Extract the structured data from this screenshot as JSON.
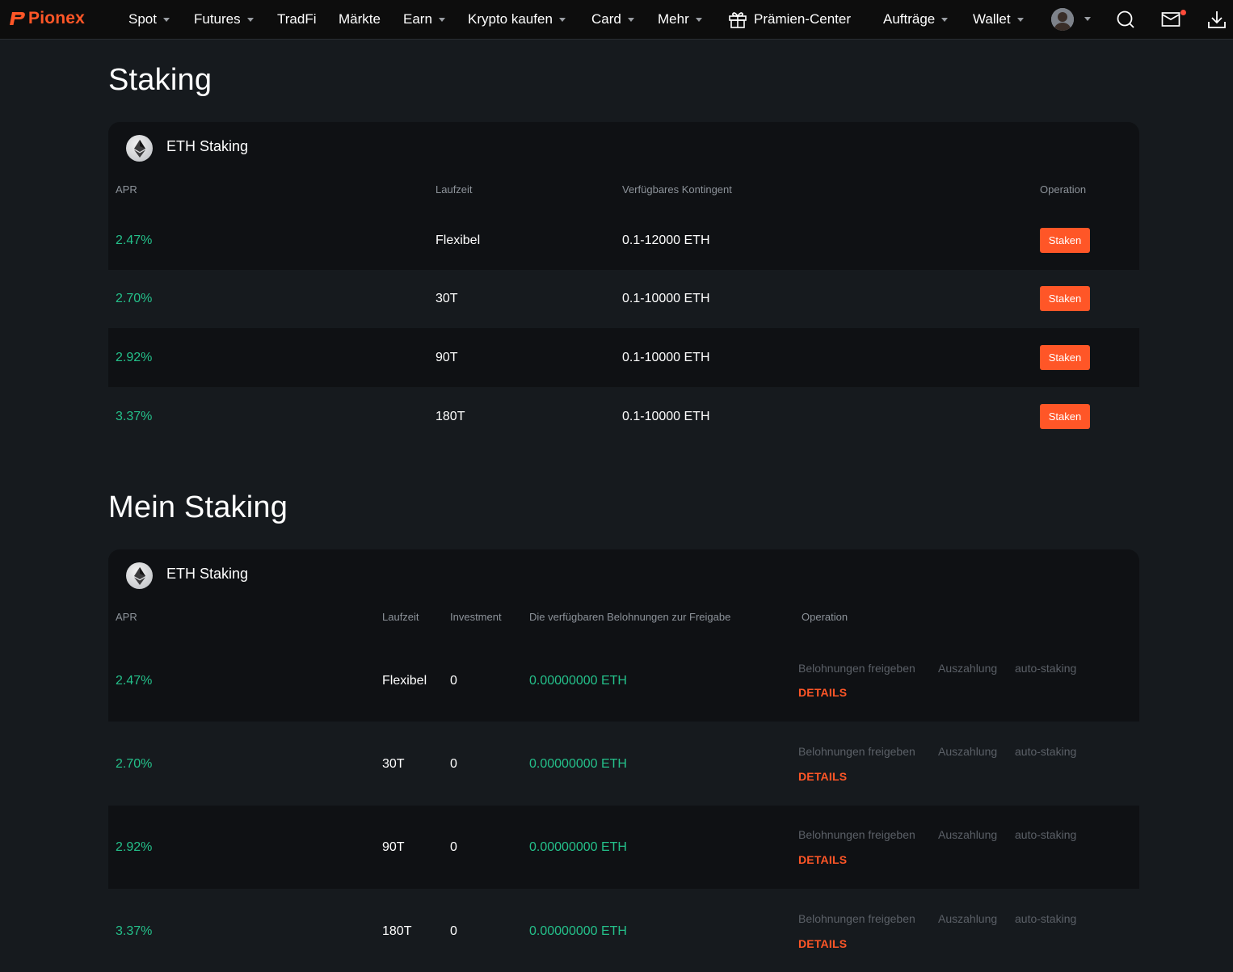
{
  "nav": {
    "brand": "Pionex",
    "items": [
      {
        "label": "Spot",
        "dropdown": true
      },
      {
        "label": "Futures",
        "dropdown": true
      },
      {
        "label": "TradFi",
        "dropdown": false
      },
      {
        "label": "Märkte",
        "dropdown": false
      },
      {
        "label": "Earn",
        "dropdown": true
      },
      {
        "label": "Krypto kaufen",
        "dropdown": true
      },
      {
        "label": "Card",
        "dropdown": true
      },
      {
        "label": "Mehr",
        "dropdown": true
      },
      {
        "label": "Prämien-Center",
        "dropdown": false
      },
      {
        "label": "Aufträge",
        "dropdown": true
      },
      {
        "label": "Wallet",
        "dropdown": true
      }
    ],
    "icons": [
      "gift-icon",
      "avatar",
      "search-icon",
      "mail-icon",
      "download-icon"
    ],
    "accent": "#ff5627"
  },
  "staking": {
    "title": "Staking",
    "card_name": "ETH Staking",
    "headers": {
      "apr": "APR",
      "duration": "Laufzeit",
      "quota": "Verfügbares Kontingent",
      "operation": "Operation"
    },
    "rows": [
      {
        "apr": "2.47%",
        "duration": "Flexibel",
        "quota": "0.1-12000 ETH",
        "button": "Staken"
      },
      {
        "apr": "2.70%",
        "duration": "30T",
        "quota": "0.1-10000 ETH",
        "button": "Staken"
      },
      {
        "apr": "2.92%",
        "duration": "90T",
        "quota": "0.1-10000 ETH",
        "button": "Staken"
      },
      {
        "apr": "3.37%",
        "duration": "180T",
        "quota": "0.1-10000 ETH",
        "button": "Staken"
      }
    ]
  },
  "my_staking": {
    "title": "Mein Staking",
    "card_name": "ETH Staking",
    "headers": {
      "apr": "APR",
      "duration": "Laufzeit",
      "investment": "Investment",
      "rewards": "Die verfügbaren Belohnungen zur Freigabe",
      "operation": "Operation"
    },
    "actions": {
      "release": "Belohnungen freigeben",
      "withdraw": "Auszahlung",
      "auto": "auto-staking",
      "details": "DETAILS"
    },
    "rows": [
      {
        "apr": "2.47%",
        "duration": "Flexibel",
        "investment": "0",
        "rewards": "0.00000000 ETH"
      },
      {
        "apr": "2.70%",
        "duration": "30T",
        "investment": "0",
        "rewards": "0.00000000 ETH"
      },
      {
        "apr": "2.92%",
        "duration": "90T",
        "investment": "0",
        "rewards": "0.00000000 ETH"
      },
      {
        "apr": "3.37%",
        "duration": "180T",
        "investment": "0",
        "rewards": "0.00000000 ETH"
      }
    ]
  },
  "colors": {
    "positive": "#24c08a",
    "accent": "#ff5627",
    "background": "#161a1e"
  }
}
